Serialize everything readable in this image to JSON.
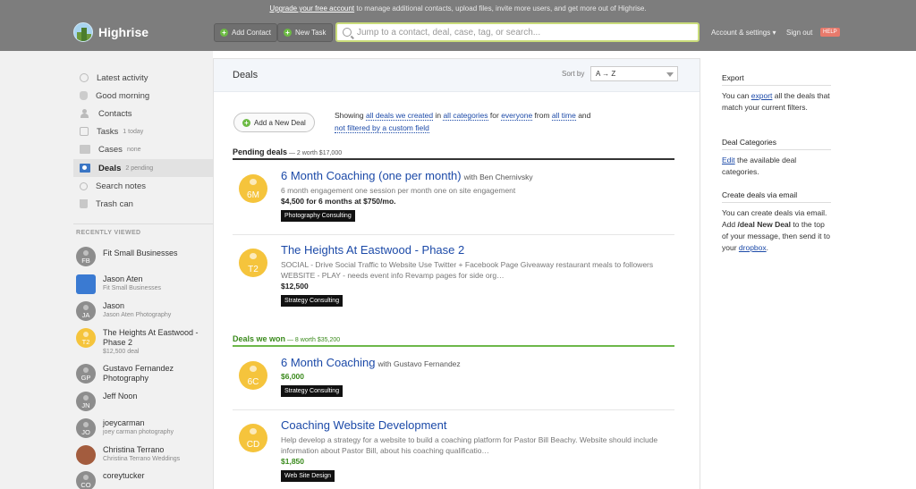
{
  "topbar": {
    "upgrade_link": "Upgrade your free account",
    "upgrade_rest": " to manage additional contacts, upload files, invite more users, and get more out of Highrise.",
    "logo_text": "Highrise",
    "add_contact": "Add Contact",
    "new_task": "New Task",
    "search_placeholder": "Jump to a contact, deal, case, tag, or search...",
    "account": "Account & settings ▾",
    "sign_out": "Sign out",
    "help": "HELP"
  },
  "sidebar": {
    "nav": [
      {
        "label": "Latest activity",
        "sub": ""
      },
      {
        "label": "Good morning",
        "sub": ""
      },
      {
        "label": "Contacts",
        "sub": ""
      },
      {
        "label": "Tasks",
        "sub": "1 today"
      },
      {
        "label": "Cases",
        "sub": "none"
      },
      {
        "label": "Deals",
        "sub": "2 pending"
      },
      {
        "label": "Search notes",
        "sub": ""
      },
      {
        "label": "Trash can",
        "sub": ""
      }
    ],
    "recently_viewed_heading": "RECENTLY VIEWED",
    "recent": [
      {
        "initials": "FB",
        "name": "Fit Small Businesses",
        "sub": ""
      },
      {
        "initials": "",
        "name": "Jason Aten",
        "sub": "Fit Small Businesses"
      },
      {
        "initials": "JA",
        "name": "Jason",
        "sub": "Jason Aten Photography"
      },
      {
        "initials": "T2",
        "name": "The Heights At Eastwood - Phase 2",
        "sub": "$12,500 deal"
      },
      {
        "initials": "GP",
        "name": "Gustavo Fernandez Photography",
        "sub": ""
      },
      {
        "initials": "JN",
        "name": "Jeff Noon",
        "sub": ""
      },
      {
        "initials": "JO",
        "name": "joeycarman",
        "sub": "joey carman photography"
      },
      {
        "initials": "",
        "name": "Christina Terrano",
        "sub": "Christina Terrano Weddings"
      },
      {
        "initials": "CO",
        "name": "coreytucker",
        "sub": ""
      }
    ]
  },
  "main": {
    "title": "Deals",
    "sort_label": "Sort by",
    "sort_value": "A → Z",
    "add_deal": "Add a New Deal",
    "showing": {
      "t1": "Showing ",
      "l1": "all deals we created",
      "t2": " in ",
      "l2": "all categories",
      "t3": " for ",
      "l3": "everyone",
      "t4": " from ",
      "l4": "all time",
      "t5": " and",
      "l5": "not filtered by a custom field"
    },
    "pending": {
      "label": "Pending deals",
      "count": " — 2 worth $17,000",
      "deals": [
        {
          "initials": "6M",
          "title": "6 Month Coaching (one per month)",
          "with": "with Ben Chernivsky",
          "desc": "6 month engagement one session per month one on site engagement",
          "amount": "$4,500 for 6 months at $750/mo.",
          "tag": "Photography Consulting"
        },
        {
          "initials": "T2",
          "title": "The Heights At Eastwood - Phase 2",
          "with": "",
          "desc": "SOCIAL - Drive Social Traffic to Website Use Twitter + Facebook Page Giveaway restaurant meals to followers WEBSITE - PLAY - needs event info Revamp pages for side org…",
          "amount": "$12,500",
          "tag": "Strategy Consulting"
        }
      ]
    },
    "won": {
      "label": "Deals we won",
      "count": " — 8 worth $35,200",
      "deals": [
        {
          "initials": "6C",
          "title": "6 Month Coaching",
          "with": "with Gustavo Fernandez",
          "desc": "",
          "amount": "$6,000",
          "tag": "Strategy Consulting"
        },
        {
          "initials": "CD",
          "title": "Coaching Website Development",
          "with": "",
          "desc": "Help develop a strategy for a website to build a coaching platform for Pastor Bill Beachy. Website should include information about Pastor Bill, about his coaching qualificatio…",
          "amount": "$1,850",
          "tag": "Web Site Design"
        }
      ]
    }
  },
  "right": {
    "export_heading": "Export",
    "export_t1": "You can ",
    "export_link": "export",
    "export_t2": " all the deals that match your current filters.",
    "cat_heading": "Deal Categories",
    "cat_link": "Edit",
    "cat_t": " the available deal categories.",
    "email_heading": "Create deals via email",
    "email_t1": "You can create deals via email. Add ",
    "email_b": "/deal New Deal",
    "email_t2": " to the top of your message, then send it to your ",
    "email_link": "dropbox",
    "email_t3": "."
  }
}
